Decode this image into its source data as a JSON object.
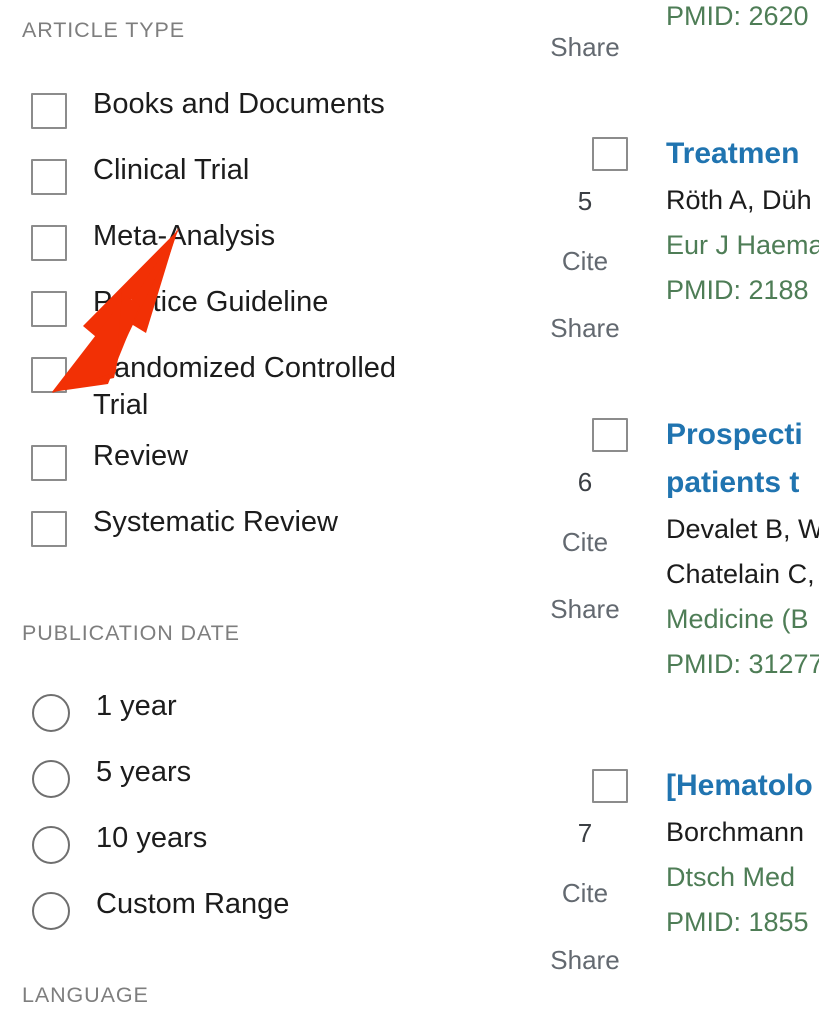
{
  "filters": {
    "article_type": {
      "header": "ARTICLE TYPE",
      "options": [
        {
          "label": "Books and Documents",
          "checked": false
        },
        {
          "label": "Clinical Trial",
          "checked": false
        },
        {
          "label": "Meta-Analysis",
          "checked": false
        },
        {
          "label": "Practice Guideline",
          "checked": false
        },
        {
          "label": "Randomized Controlled Trial",
          "checked": false
        },
        {
          "label": "Review",
          "checked": false
        },
        {
          "label": "Systematic Review",
          "checked": false
        }
      ]
    },
    "publication_date": {
      "header": "PUBLICATION DATE",
      "options": [
        {
          "label": "1 year",
          "selected": false
        },
        {
          "label": "5 years",
          "selected": false
        },
        {
          "label": "10 years",
          "selected": false
        },
        {
          "label": "Custom Range",
          "selected": false
        }
      ]
    },
    "language": {
      "header": "LANGUAGE"
    }
  },
  "annotation": {
    "type": "arrow",
    "color": "#f23005",
    "points_to": "Randomized Controlled Trial checkbox"
  },
  "results": {
    "partial_top_result": {
      "pmid": "PMID: 2620",
      "share_label": "Share"
    },
    "items": [
      {
        "number": "5",
        "cite_label": "Cite",
        "share_label": "Share",
        "title": "Treatmen",
        "authors": "Röth A, Düh",
        "journal": "Eur J Haema",
        "pmid": "PMID: 2188"
      },
      {
        "number": "6",
        "cite_label": "Cite",
        "share_label": "Share",
        "title_line1": "Prospecti",
        "title_line2": "patients t",
        "authors_line1": "Devalet B, W",
        "authors_line2": "Chatelain C,",
        "journal": "Medicine (B",
        "pmid": "PMID: 31277"
      },
      {
        "number": "7",
        "cite_label": "Cite",
        "share_label": "Share",
        "title": "[Hematolo",
        "authors": "Borchmann",
        "journal": "Dtsch Med ",
        "pmid": "PMID: 1855"
      }
    ]
  },
  "colors": {
    "link_blue": "#2074b0",
    "journal_green": "#4e7d56",
    "action_gray": "#636970",
    "facet_header_gray": "#7e7e7e",
    "annotation_red": "#f23005",
    "body_text": "#1c1c1c"
  }
}
